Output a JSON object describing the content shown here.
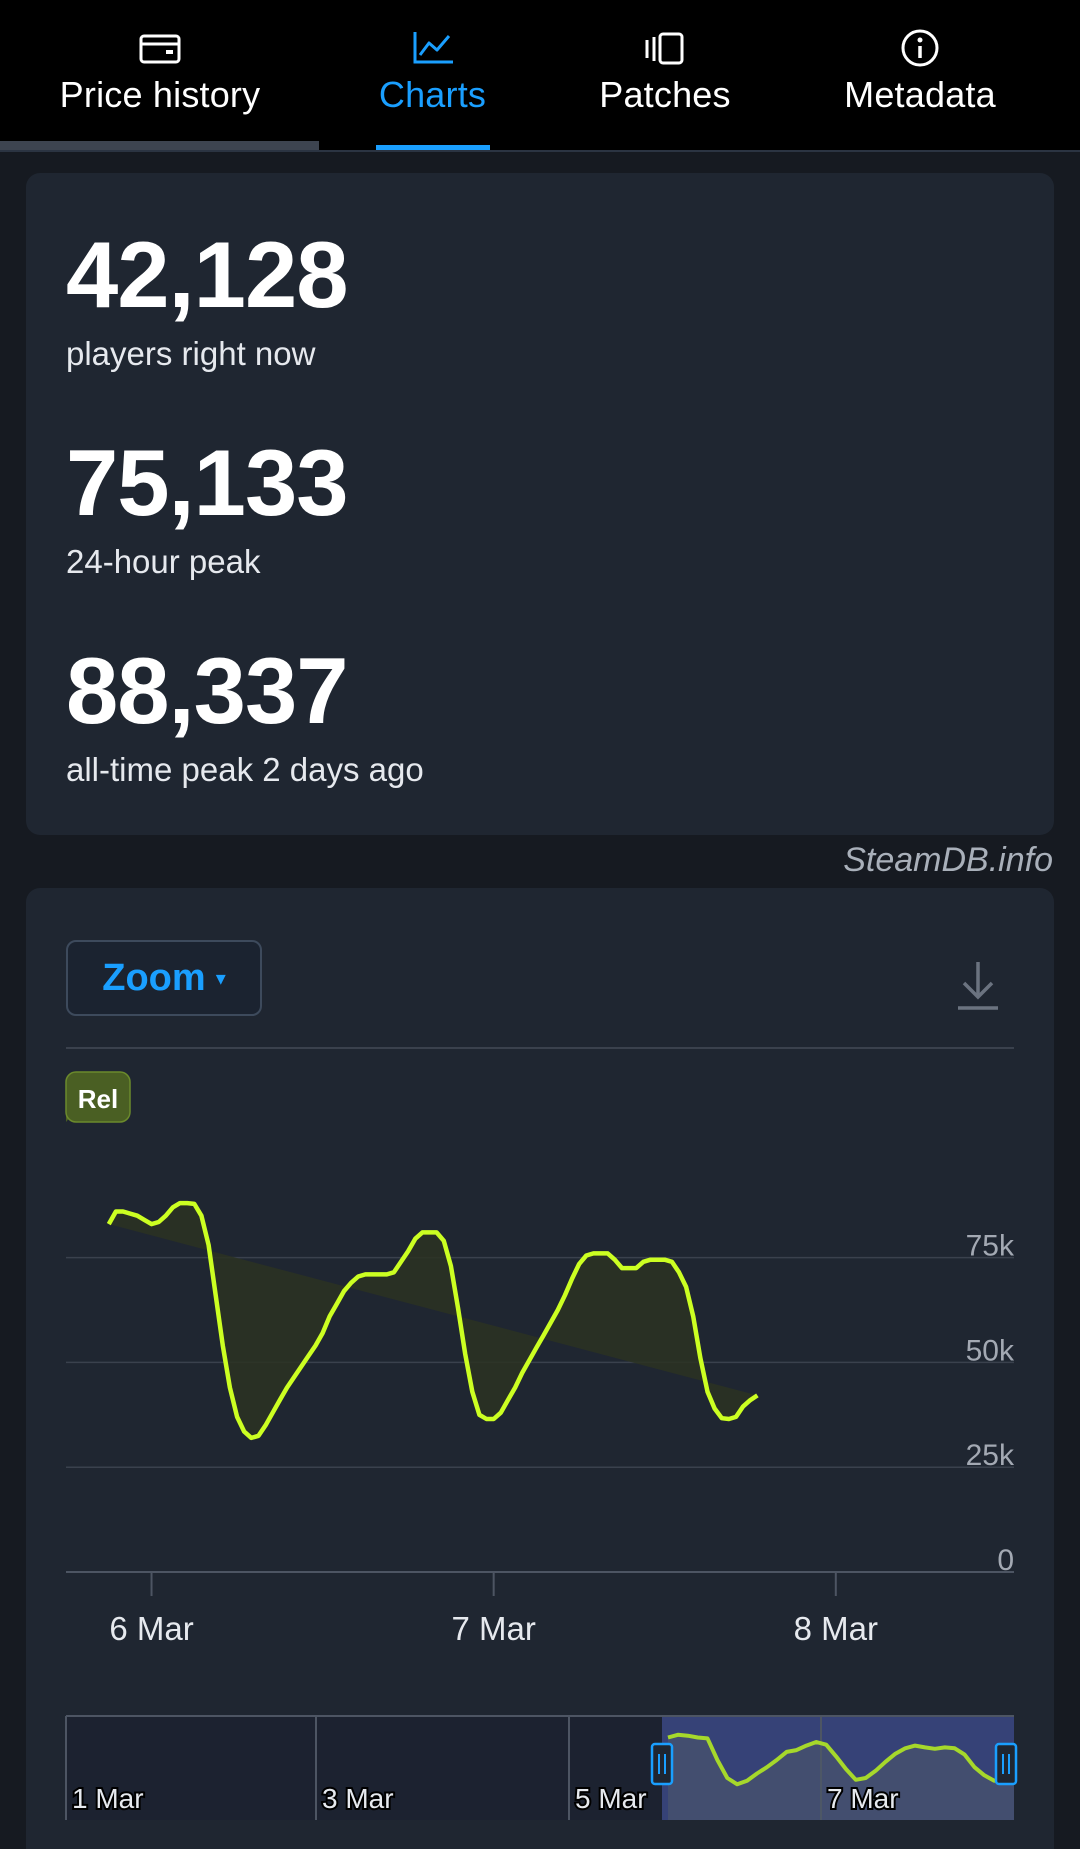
{
  "tabs": [
    {
      "label": "Price history",
      "icon": "wallet-icon",
      "active": false
    },
    {
      "label": "Charts",
      "icon": "line-chart-icon",
      "active": true
    },
    {
      "label": "Patches",
      "icon": "patches-icon",
      "active": false
    },
    {
      "label": "Metadata",
      "icon": "info-icon",
      "active": false
    }
  ],
  "stats": {
    "current_value": "42,128",
    "current_label": "players right now",
    "peak24_value": "75,133",
    "peak24_label": "24-hour peak",
    "alltime_value": "88,337",
    "alltime_label": "all-time peak 2 days ago"
  },
  "attribution": "SteamDB.info",
  "chart": {
    "zoom_label": "Zoom",
    "zoom_caret": "▾",
    "marker_label": "Rel"
  },
  "colors": {
    "accent": "#1a9fff",
    "line": "#ccff22",
    "card": "#1f2631",
    "navigator_selection": "#3a4680"
  },
  "chart_data": {
    "type": "area",
    "x_unit": "hours since 6 Mar 00:00",
    "x": [
      -3,
      -2.5,
      -2,
      -1.5,
      -1,
      -0.5,
      0,
      0.5,
      1,
      1.5,
      2,
      2.5,
      3,
      3.5,
      4,
      4.5,
      5,
      5.5,
      6,
      6.5,
      7,
      7.5,
      8,
      8.5,
      9,
      9.5,
      10,
      10.5,
      11,
      11.5,
      12,
      12.5,
      13,
      13.5,
      14,
      14.5,
      15,
      15.5,
      16,
      16.5,
      17,
      17.5,
      18,
      18.5,
      19,
      19.5,
      20,
      20.5,
      21,
      21.5,
      22,
      22.5,
      23,
      23.5,
      24,
      24.5,
      25,
      25.5,
      26,
      26.5,
      27,
      27.5,
      28,
      28.5,
      29,
      29.5,
      30,
      30.5,
      31,
      31.5,
      32,
      32.5,
      33,
      33.5,
      34,
      34.5,
      35,
      35.5,
      36,
      36.5,
      37,
      37.5,
      38,
      38.5,
      39,
      39.5,
      40,
      40.5,
      41,
      41.5,
      42,
      42.5,
      43,
      43.5,
      44,
      44.5,
      45,
      45.5,
      46
    ],
    "series": [
      {
        "name": "Players",
        "values": [
          83000,
          86000,
          86000,
          85500,
          85000,
          84000,
          83000,
          83500,
          85000,
          87000,
          88000,
          88000,
          87800,
          85000,
          78000,
          66000,
          54000,
          44000,
          37000,
          33500,
          32000,
          32500,
          35000,
          38000,
          41000,
          44000,
          46500,
          49000,
          51500,
          54000,
          57000,
          61000,
          64000,
          67000,
          69000,
          70500,
          71000,
          71000,
          71000,
          71000,
          71500,
          74000,
          76500,
          79500,
          81000,
          81000,
          81000,
          79000,
          73000,
          63000,
          52000,
          43000,
          37500,
          36500,
          36500,
          38000,
          41000,
          44000,
          47500,
          50500,
          53500,
          56500,
          59500,
          62500,
          66000,
          70000,
          73500,
          75500,
          76000,
          76000,
          76000,
          74500,
          72500,
          72500,
          72500,
          74000,
          74500,
          74500,
          74500,
          74000,
          71500,
          68000,
          61000,
          51000,
          43000,
          39000,
          36700,
          36500,
          37000,
          39500,
          41000,
          42128
        ]
      }
    ],
    "x_ticks": [
      {
        "x": 0,
        "label": "6 Mar"
      },
      {
        "x": 24,
        "label": "7 Mar"
      },
      {
        "x": 48,
        "label": "8 Mar"
      }
    ],
    "y_ticks": [
      "0",
      "25k",
      "50k",
      "75k"
    ],
    "ylim": [
      0,
      100000
    ],
    "xlim": [
      -6,
      60.5
    ],
    "grid": true,
    "navigator": {
      "x_ticks": [
        "1 Mar",
        "3 Mar",
        "5 Mar",
        "7 Mar"
      ],
      "values": [
        85000,
        88000,
        87000,
        85000,
        84000,
        60000,
        40000,
        33000,
        37000,
        45000,
        52000,
        60000,
        69000,
        71000,
        76000,
        80000,
        77000,
        64000,
        50000,
        38000,
        40000,
        48000,
        58000,
        67000,
        73000,
        76000,
        74000,
        72500,
        74000,
        73000,
        66000,
        52000,
        43000,
        37000,
        38000,
        42000
      ]
    }
  }
}
